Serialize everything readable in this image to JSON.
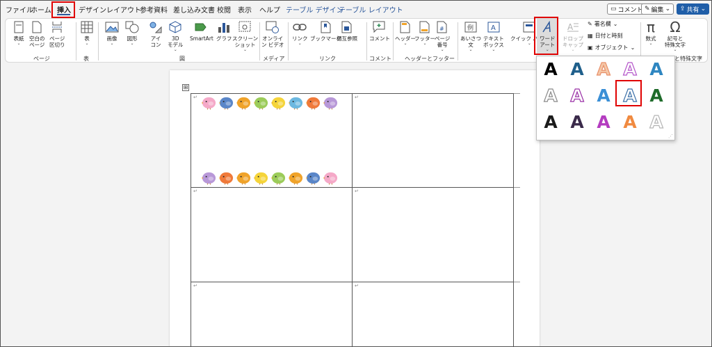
{
  "tabs": [
    "ファイル",
    "ホーム",
    "挿入",
    "デザイン",
    "レイアウト",
    "参考資料",
    "差し込み文書",
    "校閲",
    "表示",
    "ヘルプ",
    "テーブル デザイン",
    "テーブル レイアウト"
  ],
  "top_buttons": {
    "comment": "コメント",
    "edit": "編集",
    "share": "共有"
  },
  "ribbon": {
    "page_buttons": [
      "表紙",
      "空白の\nページ",
      "ページ\n区切り"
    ],
    "page_group": "ページ",
    "table_button": "表",
    "table_group": "表",
    "illustration_buttons": [
      "画像",
      "図形",
      "アイ\nコン",
      "3D\nモデル",
      "SmartArt",
      "グラフ",
      "スクリーン\nショット"
    ],
    "illustration_group": "図",
    "media_button": "オンライ\nン ビデオ",
    "media_group": "メディア",
    "link_buttons": [
      "リンク",
      "ブックマーク",
      "相互参照"
    ],
    "link_group": "リンク",
    "comment_button": "コメント",
    "comment_group": "コメント",
    "hf_buttons": [
      "ヘッダー",
      "フッター",
      "ページ\n番号"
    ],
    "hf_group": "ヘッダーとフッター",
    "text_buttons": [
      "あいさつ\n文",
      "テキスト\nボックス",
      "クイック パーツ",
      "ワード\nアート",
      "ドロップ\nキャップ"
    ],
    "text_small": [
      "署名欄",
      "日付と時刻",
      "オブジェクト"
    ],
    "symbol_buttons": [
      "数式",
      "記号と\n特殊文字"
    ],
    "symbol_group": "記号と特殊文字"
  },
  "wordart_letter": "A",
  "wordart_styles": [
    {
      "fill": "#000000",
      "stroke": "none"
    },
    {
      "fill": "#1f5f8b",
      "stroke": "none"
    },
    {
      "fill": "#f5c8a8",
      "stroke": "#e8906a"
    },
    {
      "fill": "#ffffff",
      "stroke": "#b455c9"
    },
    {
      "fill": "#2e86c1",
      "stroke": "none"
    },
    {
      "fill": "#ffffff",
      "stroke": "#8a8a8a"
    },
    {
      "fill": "#ffffff",
      "stroke": "#9a2fa6"
    },
    {
      "fill": "#3a8fd6",
      "stroke": "none"
    },
    {
      "fill": "#ffffff",
      "stroke": "#3a6fa8"
    },
    {
      "fill": "#1e6b2a",
      "stroke": "none"
    },
    {
      "fill": "#1b1b1b",
      "stroke": "none"
    },
    {
      "fill": "#3a2a4a",
      "stroke": "none"
    },
    {
      "fill": "#b43cc0",
      "stroke": "none"
    },
    {
      "fill": "#f08a40",
      "stroke": "none"
    },
    {
      "fill": "#ffffff",
      "stroke": "#b5b5b5"
    }
  ],
  "bird_colors_top": [
    "#f5a9c8",
    "#5a86c8",
    "#f0a32a",
    "#9ccc5a",
    "#f5d43a",
    "#6cb8e0",
    "#f07a3a",
    "#b898d8"
  ],
  "bird_colors_bottom": [
    "#b898d8",
    "#f07a3a",
    "#f0a32a",
    "#f5d43a",
    "#9ccc5a",
    "#f0a32a",
    "#5a86c8",
    "#f5a9c8"
  ],
  "para_mark": "↵",
  "table_handle": "⊞"
}
